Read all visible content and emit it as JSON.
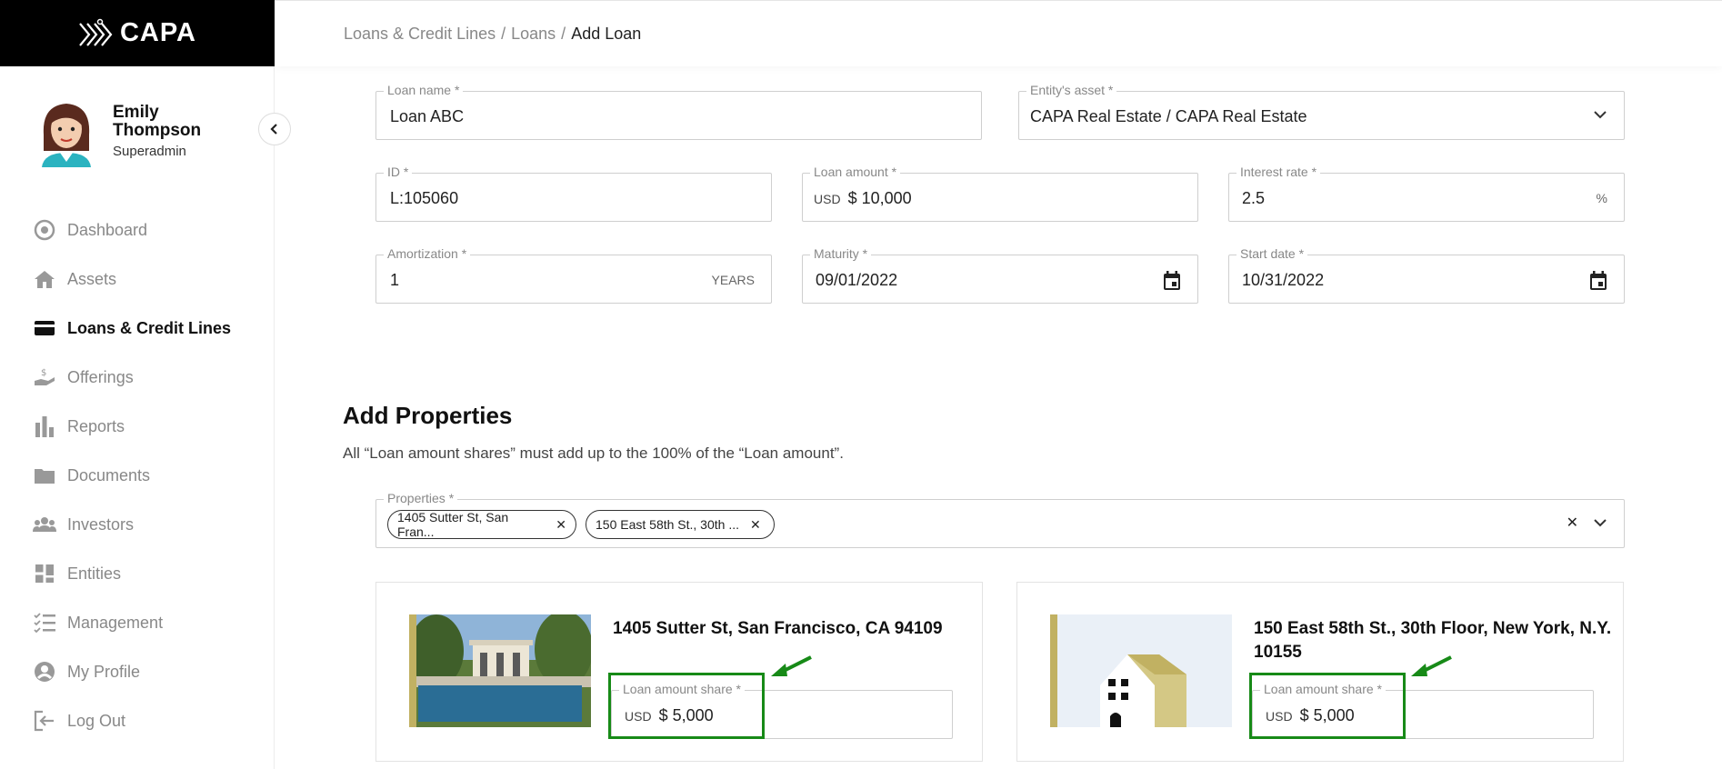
{
  "app": {
    "logo_text": "CAPA"
  },
  "user": {
    "name": "Emily Thompson",
    "role": "Superadmin"
  },
  "nav": [
    {
      "label": "Dashboard",
      "icon": "dashboard-icon"
    },
    {
      "label": "Assets",
      "icon": "home-icon"
    },
    {
      "label": "Loans & Credit Lines",
      "icon": "credit-card-icon"
    },
    {
      "label": "Offerings",
      "icon": "offerings-icon"
    },
    {
      "label": "Reports",
      "icon": "bar-chart-icon"
    },
    {
      "label": "Documents",
      "icon": "folder-icon"
    },
    {
      "label": "Investors",
      "icon": "users-icon"
    },
    {
      "label": "Entities",
      "icon": "grid-icon"
    },
    {
      "label": "Management",
      "icon": "checklist-icon"
    },
    {
      "label": "My Profile",
      "icon": "user-circle-icon"
    },
    {
      "label": "Log Out",
      "icon": "logout-icon"
    }
  ],
  "breadcrumb": {
    "item1": "Loans & Credit Lines",
    "item2": "Loans",
    "current": "Add Loan",
    "sep": "/"
  },
  "form": {
    "loan_name": {
      "label": "Loan name *",
      "value": "Loan ABC"
    },
    "entity_asset": {
      "label": "Entity's asset *",
      "value": "CAPA Real Estate / CAPA Real Estate"
    },
    "id": {
      "label": "ID *",
      "value": "L:105060"
    },
    "loan_amount": {
      "label": "Loan amount *",
      "currency": "USD",
      "value": "$ 10,000"
    },
    "interest_rate": {
      "label": "Interest rate *",
      "value": "2.5",
      "suffix": "%"
    },
    "amortization": {
      "label": "Amortization *",
      "value": "1",
      "suffix": "YEARS"
    },
    "maturity": {
      "label": "Maturity *",
      "value": "09/01/2022"
    },
    "start_date": {
      "label": "Start date *",
      "value": "10/31/2022"
    }
  },
  "properties_section": {
    "title": "Add Properties",
    "description": "All “Loan amount shares” must add up to the 100% of the “Loan amount”.",
    "select_label": "Properties *",
    "chips": [
      "1405 Sutter St, San Fran...",
      "150 East 58th St., 30th ..."
    ]
  },
  "cards": [
    {
      "title": "1405 Sutter St, San Francisco, CA 94109",
      "share_label": "Loan amount share *",
      "currency": "USD",
      "share_value": "$ 5,000"
    },
    {
      "title": "150 East 58th St., 30th Floor, New York, N.Y. 10155",
      "share_label": "Loan amount share *",
      "currency": "USD",
      "share_value": "$ 5,000"
    }
  ],
  "colors": {
    "highlight": "#178a17",
    "accent_gold": "#c1b162",
    "sidebar_active": "#111111"
  }
}
